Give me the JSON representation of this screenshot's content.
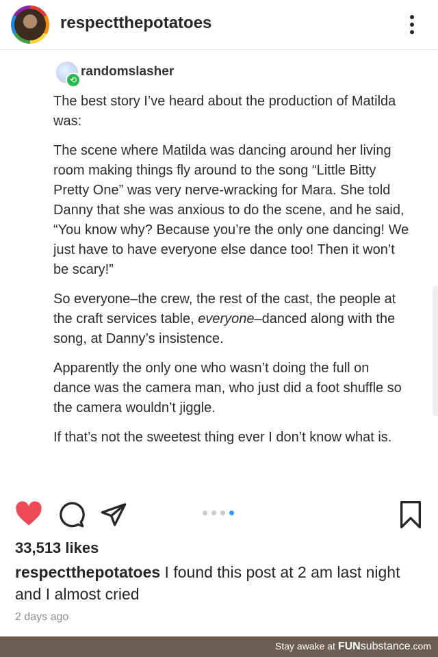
{
  "header": {
    "username": "respectthepotatoes",
    "more_icon": "more-vertical-icon"
  },
  "reblog": {
    "source_username": "randomslasher",
    "badge_icon": "reblog-icon"
  },
  "post": {
    "paragraphs": [
      "The best story I’ve heard about the production of Matilda was:",
      "The scene where Matilda was dancing around her living room making things fly around to the song “Little Bitty Pretty One” was very nerve-wracking for Mara. She told Danny that she was anxious to do the scene, and he said, “You know why? Because you’re the only one dancing! We just have to have everyone else dance too! Then it won’t be scary!”",
      "Apparently the only one who wasn’t doing the full on dance was the camera man, who just did a foot shuffle so the camera wouldn’t jiggle.",
      "If that’s not the sweetest thing ever I don’t know what is."
    ],
    "p3_before": "So everyone–the crew, the rest of the cast, the people at the craft services table, ",
    "p3_emphasis": "everyone",
    "p3_after": "–danced along with the song, at Danny’s insistence."
  },
  "actions": {
    "like_icon": "heart-icon",
    "comment_icon": "comment-icon",
    "share_icon": "send-icon",
    "save_icon": "bookmark-icon",
    "carousel_total": 4,
    "carousel_active": 4
  },
  "likes": "33,513 likes",
  "caption": {
    "username": "respectthepotatoes",
    "text": " I found this post at 2 am last night and I almost cried"
  },
  "timestamp": "2 days ago",
  "watermark": {
    "prefix": "Stay awake at ",
    "brand_bold": "FUN",
    "brand_rest": "substance",
    "suffix": ".com"
  },
  "colors": {
    "like": "#ed4956",
    "carousel_active": "#3897f0",
    "footer_bg": "#6b5d52"
  }
}
